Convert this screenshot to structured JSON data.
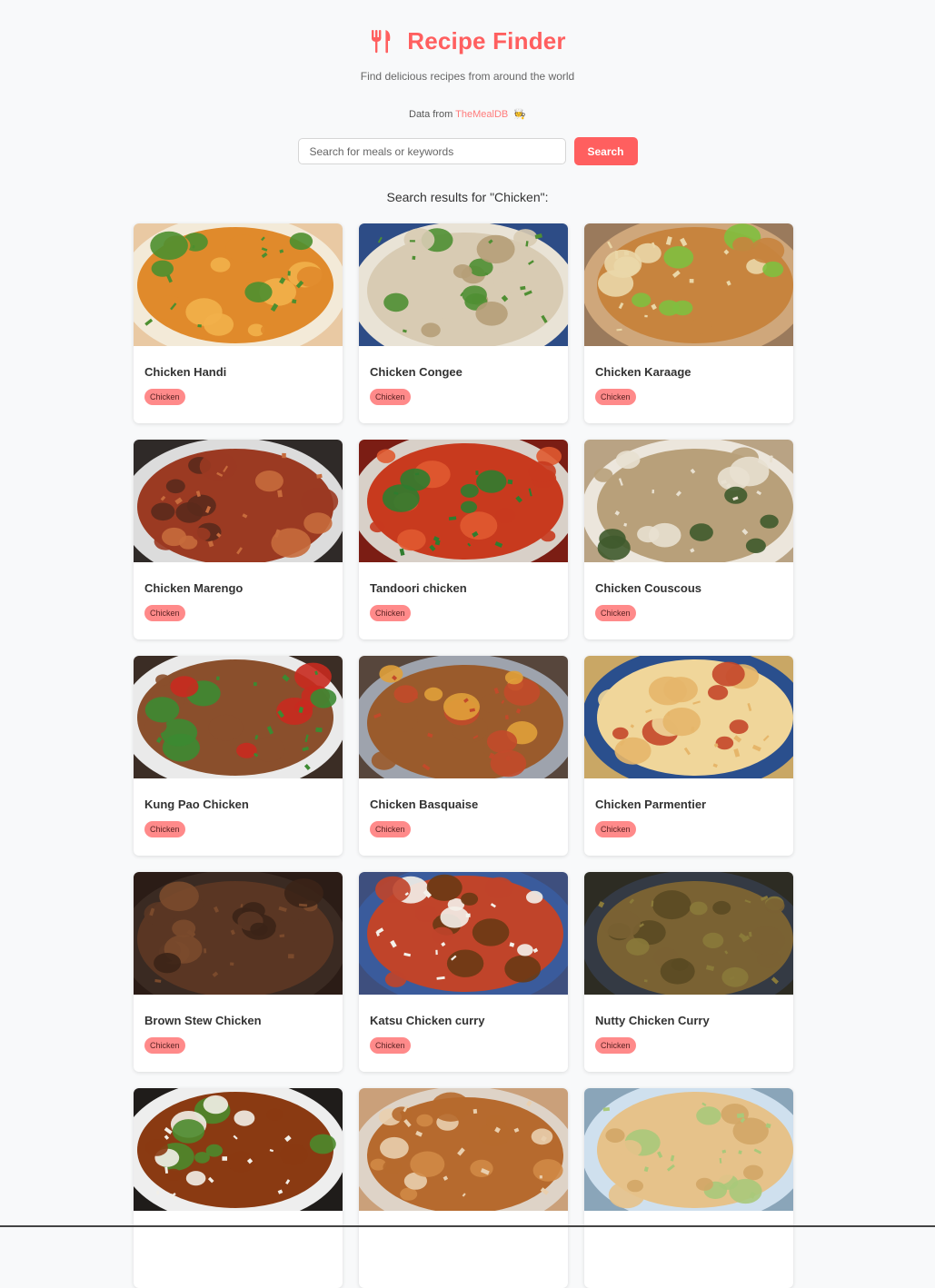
{
  "header": {
    "title": "Recipe Finder",
    "subtitle": "Find delicious recipes from around the world",
    "source_prefix": "Data from",
    "source_link": "TheMealDB",
    "source_emoji": "🧑‍🍳"
  },
  "search": {
    "placeholder": "Search for meals or keywords",
    "value": "",
    "button_label": "Search"
  },
  "results": {
    "heading": "Search results for \"Chicken\":",
    "cards": [
      {
        "title": "Chicken Handi",
        "category": "Chicken",
        "image": "chicken-handi"
      },
      {
        "title": "Chicken Congee",
        "category": "Chicken",
        "image": "chicken-congee"
      },
      {
        "title": "Chicken Karaage",
        "category": "Chicken",
        "image": "chicken-karaage"
      },
      {
        "title": "Chicken Marengo",
        "category": "Chicken",
        "image": "chicken-marengo"
      },
      {
        "title": "Tandoori chicken",
        "category": "Chicken",
        "image": "tandoori-chicken"
      },
      {
        "title": "Chicken Couscous",
        "category": "Chicken",
        "image": "chicken-couscous"
      },
      {
        "title": "Kung Pao Chicken",
        "category": "Chicken",
        "image": "kung-pao-chicken"
      },
      {
        "title": "Chicken Basquaise",
        "category": "Chicken",
        "image": "chicken-basquaise"
      },
      {
        "title": "Chicken Parmentier",
        "category": "Chicken",
        "image": "chicken-parmentier"
      },
      {
        "title": "Brown Stew Chicken",
        "category": "Chicken",
        "image": "brown-stew-chicken"
      },
      {
        "title": "Katsu Chicken curry",
        "category": "Chicken",
        "image": "katsu-chicken-curry"
      },
      {
        "title": "Nutty Chicken Curry",
        "category": "Chicken",
        "image": "nutty-chicken-curry"
      },
      {
        "title": "",
        "category": "",
        "image": "teriyaki-chicken"
      },
      {
        "title": "",
        "category": "",
        "image": "fried-chicken"
      },
      {
        "title": "",
        "category": "",
        "image": "chicken-pie"
      }
    ]
  },
  "colors": {
    "accent": "#ff5f5f",
    "badge": "#ff8a8a",
    "background": "#f8f9fa"
  }
}
